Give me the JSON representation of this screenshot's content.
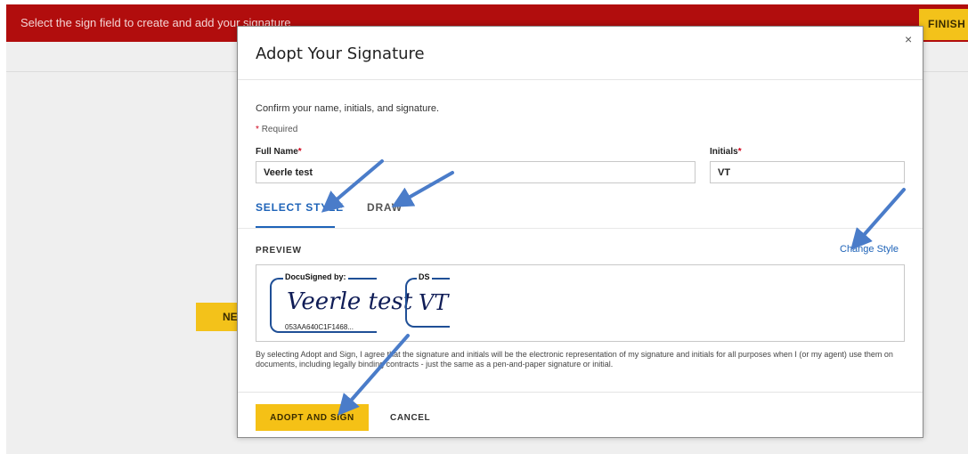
{
  "top_bar": {
    "instruction": "Select the sign field to create and add your signature",
    "finish_label": "FINISH"
  },
  "background": {
    "next_label": "NE"
  },
  "modal": {
    "title": "Adopt Your Signature",
    "close_icon": "×",
    "instructions": "Confirm your name, initials, and signature.",
    "required_star": "*",
    "required_text": "Required",
    "full_name_label": "Full Name",
    "full_name_value": "Veerle test",
    "initials_label": "Initials",
    "initials_value": "VT",
    "tabs": [
      {
        "label": "SELECT STYLE",
        "active": true
      },
      {
        "label": "DRAW",
        "active": false
      }
    ],
    "preview_label": "PREVIEW",
    "change_style_link": "Change Style",
    "signature_preview": {
      "header": "DocuSigned by:",
      "signature_text": "Veerle test",
      "envelope_id": "053AA640C1F1468..."
    },
    "initials_preview": {
      "header": "DS",
      "initials_text": "VT"
    },
    "legal_text": "By selecting Adopt and Sign, I agree that the signature and initials will be the electronic representation of my signature and initials for all purposes when I (or my agent) use them on documents, including legally binding contracts - just the same as a pen-and-paper signature or initial.",
    "adopt_button": "ADOPT AND SIGN",
    "cancel_button": "CANCEL"
  },
  "colors": {
    "top_bar": "#b10d0d",
    "accent_yellow": "#f5c116",
    "link_blue": "#1e63b8",
    "annotation_arrow": "#4a7cc9"
  },
  "icons": [
    "close-icon",
    "annotation-arrow"
  ]
}
